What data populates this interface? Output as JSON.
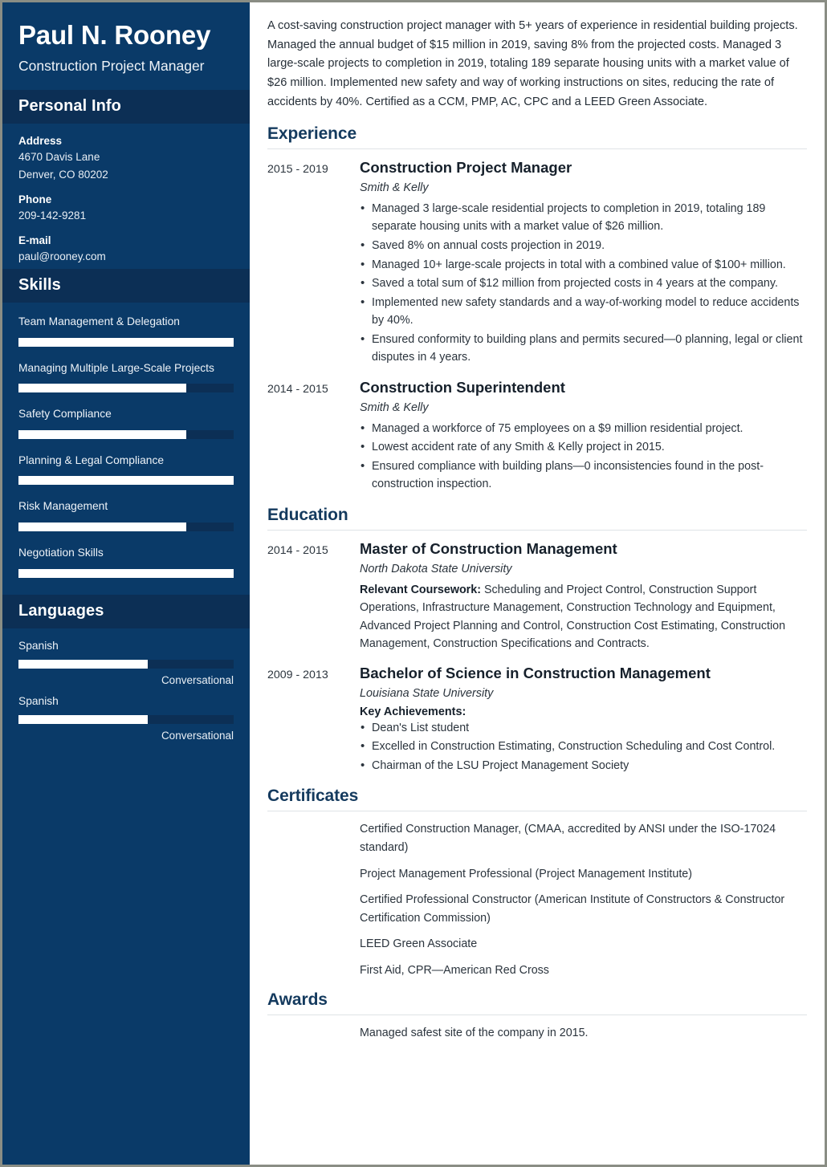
{
  "sidebar": {
    "name": "Paul N. Rooney",
    "job_title": "Construction Project Manager",
    "personal_info": {
      "heading": "Personal Info",
      "fields": [
        {
          "label": "Address",
          "value": "4670 Davis Lane\nDenver, CO 80202"
        },
        {
          "label": "Phone",
          "value": "209-142-9281"
        },
        {
          "label": "E-mail",
          "value": "paul@rooney.com"
        }
      ]
    },
    "skills": {
      "heading": "Skills",
      "items": [
        {
          "name": "Team Management & Delegation",
          "level": 100
        },
        {
          "name": "Managing Multiple Large-Scale Projects",
          "level": 78
        },
        {
          "name": "Safety Compliance",
          "level": 78
        },
        {
          "name": "Planning & Legal Compliance",
          "level": 100
        },
        {
          "name": "Risk Management",
          "level": 78
        },
        {
          "name": "Negotiation Skills",
          "level": 100
        }
      ]
    },
    "languages": {
      "heading": "Languages",
      "items": [
        {
          "name": "Spanish",
          "level": 60,
          "proficiency": "Conversational"
        },
        {
          "name": "Spanish",
          "level": 60,
          "proficiency": "Conversational"
        }
      ]
    }
  },
  "main": {
    "summary": "A cost-saving construction project manager with 5+ years of experience in residential building projects. Managed the annual budget of $15 million in 2019, saving 8% from the projected costs. Managed 3 large-scale projects to completion in 2019, totaling 189 separate housing units with a market value of $26 million. Implemented new safety and way of working instructions on sites, reducing the rate of accidents by 40%. Certified as a CCM, PMP, AC, CPC and a LEED Green Associate.",
    "experience": {
      "heading": "Experience",
      "entries": [
        {
          "dates": "2015 - 2019",
          "title": "Construction Project Manager",
          "organization": "Smith & Kelly",
          "bullets": [
            "Managed 3 large-scale residential projects to completion in 2019, totaling 189 separate housing units with a market value of $26 million.",
            "Saved 8% on annual costs projection in 2019.",
            "Managed 10+ large-scale projects in total with a combined value of $100+ million.",
            "Saved a total sum of $12 million from projected costs in 4 years at the company.",
            "Implemented new safety standards and a way-of-working model to reduce accidents by 40%.",
            "Ensured conformity to building plans and permits secured—0 planning, legal or client disputes in 4 years."
          ]
        },
        {
          "dates": "2014 - 2015",
          "title": "Construction Superintendent",
          "organization": "Smith & Kelly",
          "bullets": [
            "Managed a workforce of 75 employees on a $9 million residential project.",
            "Lowest accident rate of any Smith & Kelly project in 2015.",
            "Ensured compliance with building plans—0 inconsistencies found in the post-construction inspection."
          ]
        }
      ]
    },
    "education": {
      "heading": "Education",
      "entries": [
        {
          "dates": "2014 - 2015",
          "title": "Master of Construction Management",
          "organization": "North Dakota State University",
          "coursework_label": "Relevant Coursework:",
          "coursework": " Scheduling and Project Control, Construction Support Operations, Infrastructure Management, Construction Technology and Equipment, Advanced Project Planning and Control, Construction Cost Estimating, Construction Management, Construction Specifications and Contracts."
        },
        {
          "dates": "2009 - 2013",
          "title": "Bachelor of Science in Construction Management",
          "organization": "Louisiana State University",
          "achievements_label": "Key Achievements:",
          "bullets": [
            "Dean's List student",
            "Excelled in Construction Estimating, Construction Scheduling and Cost Control.",
            "Chairman of the LSU Project Management Society"
          ]
        }
      ]
    },
    "certificates": {
      "heading": "Certificates",
      "items": [
        "Certified Construction Manager, (CMAA, accredited by ANSI under the ISO-17024 standard)",
        "Project Management Professional (Project Management Institute)",
        "Certified Professional Constructor (American Institute of Constructors & Constructor Certification Commission)",
        "LEED Green Associate",
        "First Aid, CPR—American Red Cross"
      ]
    },
    "awards": {
      "heading": "Awards",
      "items": [
        "Managed safest site of the company in 2015."
      ]
    }
  },
  "colors": {
    "sidebar_bg": "#0a3a68",
    "sidebar_band": "#0c2f55",
    "heading": "#143a5e",
    "bar_fill": "#ffffff"
  }
}
